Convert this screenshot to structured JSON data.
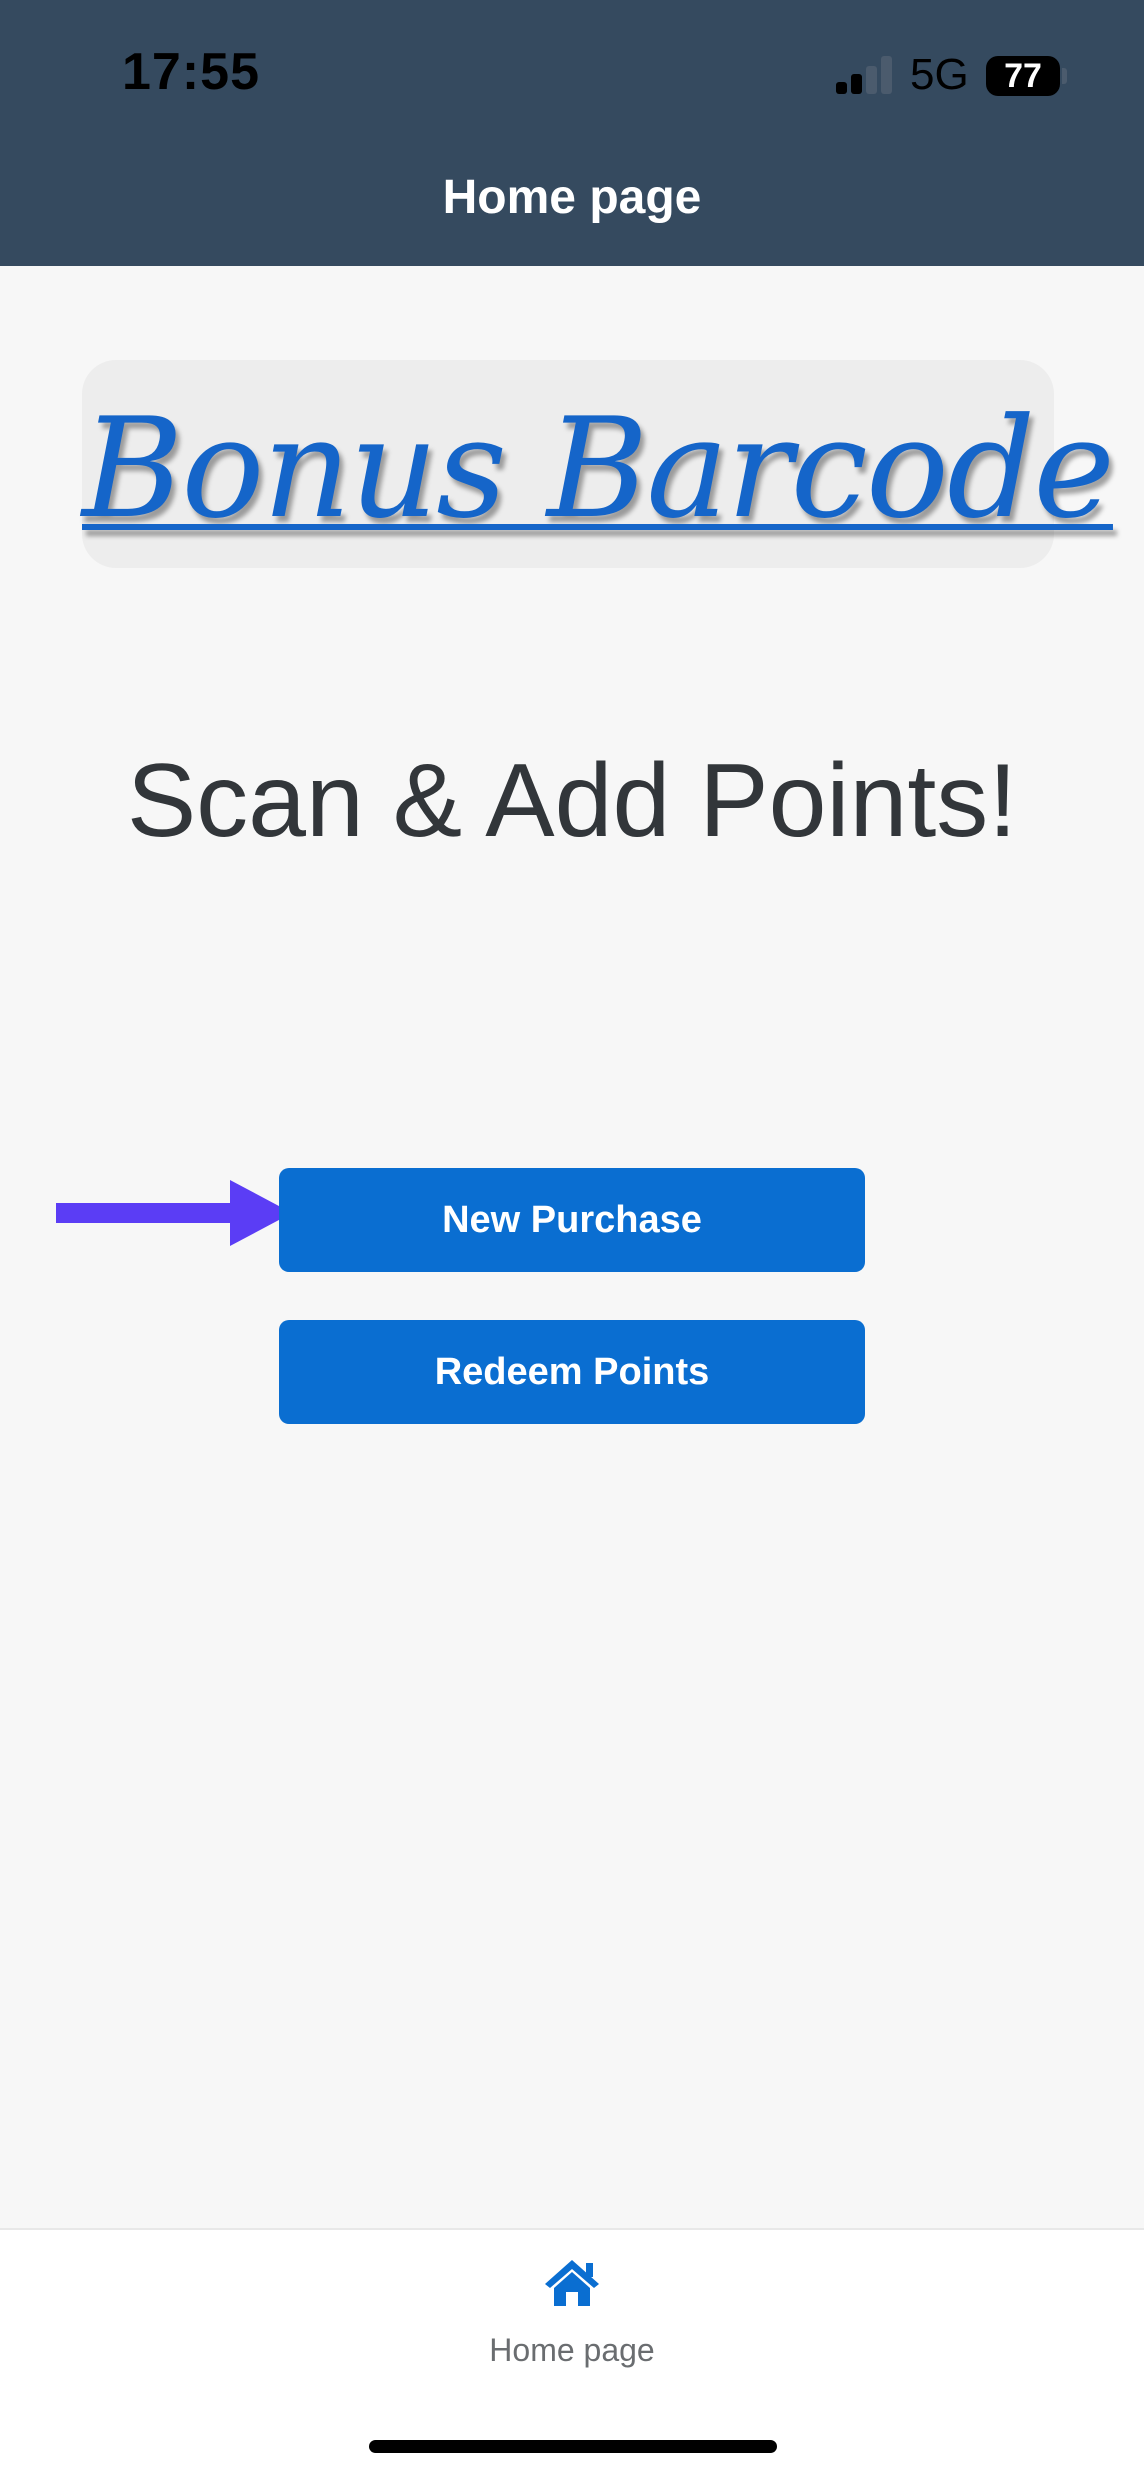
{
  "status_bar": {
    "time": "17:55",
    "network": "5G",
    "battery": "77"
  },
  "header": {
    "title": "Home page"
  },
  "logo": {
    "text": "Bonus Barcode"
  },
  "main": {
    "tagline": "Scan & Add Points!",
    "buttons": {
      "new_purchase": "New Purchase",
      "redeem_points": "Redeem Points"
    }
  },
  "tabbar": {
    "items": [
      {
        "label": "Home page",
        "icon": "home-icon",
        "active": true
      }
    ]
  },
  "colors": {
    "header_bg": "#354a5f",
    "accent": "#0a6ed1",
    "arrow": "#5b3df5",
    "page_bg": "#f7f7f7"
  }
}
